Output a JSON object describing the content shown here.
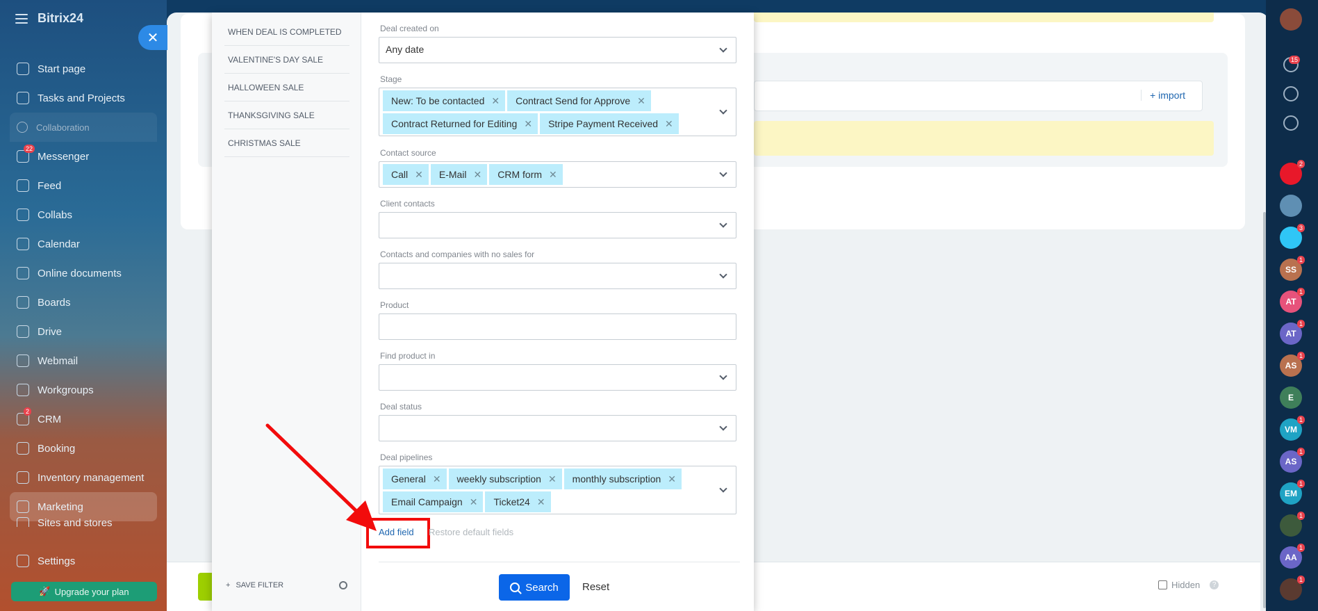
{
  "sidebar": {
    "logo": "Bitrix24",
    "items": [
      {
        "label": "Start page",
        "icon": "home-icon"
      },
      {
        "label": "Tasks and Projects",
        "icon": "tasks-icon"
      },
      {
        "label": "Collaboration",
        "icon": "collaboration-icon",
        "section": true
      },
      {
        "label": "Messenger",
        "icon": "messenger-icon",
        "badge": "22"
      },
      {
        "label": "Feed",
        "icon": "feed-icon"
      },
      {
        "label": "Collabs",
        "icon": "collabs-icon"
      },
      {
        "label": "Calendar",
        "icon": "calendar-icon"
      },
      {
        "label": "Online documents",
        "icon": "documents-icon"
      },
      {
        "label": "Boards",
        "icon": "boards-icon"
      },
      {
        "label": "Drive",
        "icon": "drive-icon"
      },
      {
        "label": "Webmail",
        "icon": "mail-icon"
      },
      {
        "label": "Workgroups",
        "icon": "workgroups-icon"
      },
      {
        "label": "CRM",
        "icon": "crm-icon",
        "badge": "2"
      },
      {
        "label": "Booking",
        "icon": "booking-icon"
      },
      {
        "label": "Inventory management",
        "icon": "inventory-icon"
      },
      {
        "label": "Marketing",
        "icon": "marketing-icon",
        "active": true
      },
      {
        "label": "Sites and stores",
        "icon": "sites-icon"
      },
      {
        "label": "Settings",
        "icon": "settings-icon"
      }
    ],
    "upgrade_label": "Upgrade your plan"
  },
  "presets": [
    "WHEN DEAL IS COMPLETED",
    "VALENTINE'S DAY SALE",
    "HALLOWEEN SALE",
    "THANKSGIVING SALE",
    "CHRISTMAS SALE"
  ],
  "save_filter_label": "SAVE FILTER",
  "fields": {
    "deal_created": {
      "label": "Deal created on",
      "value": "Any date"
    },
    "stage": {
      "label": "Stage",
      "tags": [
        "New: To be contacted",
        "Contract Send for Approve",
        "Contract Returned for Editing",
        "Stripe Payment Received"
      ]
    },
    "contact_source": {
      "label": "Contact source",
      "tags": [
        "Call",
        "E-Mail",
        "CRM form"
      ]
    },
    "client_contacts": {
      "label": "Client contacts",
      "value": ""
    },
    "no_sales": {
      "label": "Contacts and companies with no sales for",
      "value": ""
    },
    "product": {
      "label": "Product",
      "value": ""
    },
    "find_product": {
      "label": "Find product in",
      "value": ""
    },
    "deal_status": {
      "label": "Deal status",
      "value": ""
    },
    "deal_pipelines": {
      "label": "Deal pipelines",
      "tags": [
        "General",
        "weekly subscription",
        "monthly subscription",
        "Email Campaign",
        "Ticket24"
      ]
    }
  },
  "actions": {
    "add_field": "Add field",
    "restore": "Restore default fields",
    "search": "Search",
    "reset": "Reset"
  },
  "background": {
    "import_label": "+ import",
    "hidden_label": "Hidden"
  },
  "rail": [
    {
      "type": "avatar",
      "label": "",
      "color": "#8a4b3a"
    },
    {
      "type": "bell",
      "badge": "15"
    },
    {
      "type": "copilot"
    },
    {
      "type": "chat"
    },
    {
      "type": "app",
      "badge": "2",
      "color": "#e8182a"
    },
    {
      "type": "phone",
      "color": "#5f8fb3"
    },
    {
      "type": "app",
      "badge": "3",
      "color": "#2fc6f6"
    },
    {
      "type": "avatar",
      "label": "SS",
      "badge": "1",
      "color": "#b9714f"
    },
    {
      "type": "avatar",
      "label": "AT",
      "badge": "1",
      "color": "#e7527b"
    },
    {
      "type": "avatar",
      "label": "AT",
      "badge": "1",
      "color": "#6b66c7"
    },
    {
      "type": "avatar",
      "label": "AS",
      "badge": "1",
      "color": "#b9714f"
    },
    {
      "type": "avatar",
      "label": "E",
      "color": "#3f7f5a"
    },
    {
      "type": "avatar",
      "label": "VM",
      "badge": "1",
      "color": "#1fa3c4"
    },
    {
      "type": "avatar",
      "label": "AS",
      "badge": "1",
      "color": "#6b66c7"
    },
    {
      "type": "avatar",
      "label": "EM",
      "badge": "1",
      "color": "#1fa3c4"
    },
    {
      "type": "avatar",
      "label": "",
      "badge": "1",
      "color": "#3d5a3c"
    },
    {
      "type": "avatar",
      "label": "AA",
      "badge": "1",
      "color": "#6b66c7"
    },
    {
      "type": "avatar",
      "label": "",
      "badge": "1",
      "color": "#5a3a30"
    }
  ]
}
